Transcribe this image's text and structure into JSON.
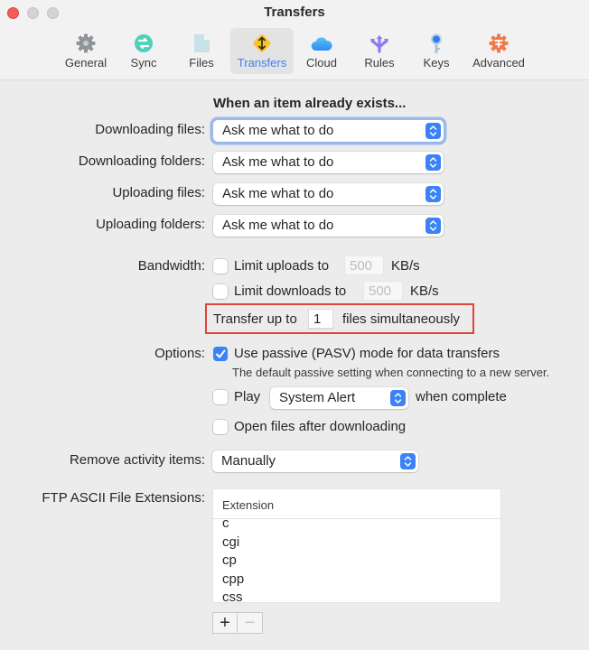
{
  "window": {
    "title": "Transfers",
    "controls": [
      "close",
      "minimize",
      "zoom"
    ]
  },
  "toolbar": {
    "tabs": [
      {
        "label": "General",
        "icon": "gear-icon",
        "active": false
      },
      {
        "label": "Sync",
        "icon": "sync-icon",
        "active": false
      },
      {
        "label": "Files",
        "icon": "file-icon",
        "active": false
      },
      {
        "label": "Transfers",
        "icon": "transfers-arrows-icon",
        "active": true
      },
      {
        "label": "Cloud",
        "icon": "cloud-icon",
        "active": false
      },
      {
        "label": "Rules",
        "icon": "rules-arrows-icon",
        "active": false
      },
      {
        "label": "Keys",
        "icon": "key-icon",
        "active": false
      },
      {
        "label": "Advanced",
        "icon": "advanced-gear-icon",
        "active": false
      }
    ],
    "accent": "#3a82f6"
  },
  "existing": {
    "heading": "When an item already exists...",
    "rows": [
      {
        "label": "Downloading files:",
        "value": "Ask me what to do",
        "focused": true
      },
      {
        "label": "Downloading folders:",
        "value": "Ask me what to do",
        "focused": false
      },
      {
        "label": "Uploading files:",
        "value": "Ask me what to do",
        "focused": false
      },
      {
        "label": "Uploading folders:",
        "value": "Ask me what to do",
        "focused": false
      }
    ]
  },
  "bandwidth": {
    "label": "Bandwidth:",
    "limit_uploads": {
      "label": "Limit uploads to",
      "checked": false,
      "value": "500",
      "unit": "KB/s"
    },
    "limit_downloads": {
      "label": "Limit downloads to",
      "checked": false,
      "value": "500",
      "unit": "KB/s"
    },
    "simultaneous": {
      "prefix": "Transfer up to",
      "value": "1",
      "suffix": "files simultaneously",
      "highlight_color": "#e0443a"
    }
  },
  "options": {
    "label": "Options:",
    "passive": {
      "label": "Use passive (PASV) mode for data transfers",
      "checked": true,
      "description": "The default passive setting when connecting to a new server."
    },
    "play": {
      "label": "Play",
      "checked": false,
      "sound": "System Alert",
      "suffix": "when complete"
    },
    "open_after": {
      "label": "Open files after downloading",
      "checked": false
    }
  },
  "remove_activity": {
    "label": "Remove activity items:",
    "value": "Manually"
  },
  "ascii": {
    "label": "FTP ASCII File Extensions:",
    "column_header": "Extension",
    "items": [
      "c",
      "cgi",
      "cp",
      "cpp",
      "css"
    ],
    "add_label": "+",
    "remove_label": "−"
  }
}
